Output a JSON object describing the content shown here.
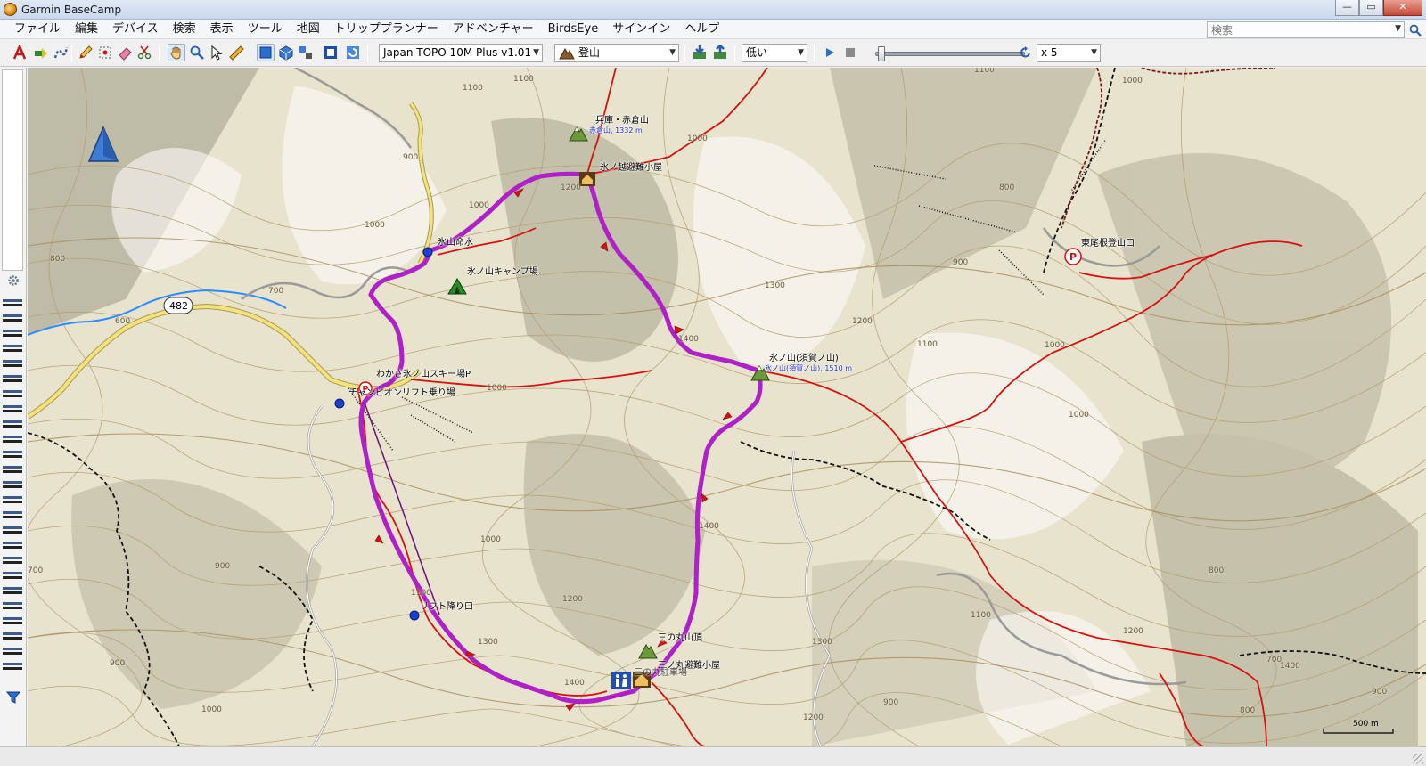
{
  "window": {
    "title": "Garmin BaseCamp",
    "minimize": "—",
    "maximize": "▭",
    "close": "✕"
  },
  "menu": [
    "ファイル",
    "編集",
    "デバイス",
    "検索",
    "表示",
    "ツール",
    "地図",
    "トリッププランナー",
    "アドベンチャー",
    "BirdsEye",
    "サインイン",
    "ヘルプ"
  ],
  "search": {
    "placeholder": "検索"
  },
  "toolbar": {
    "map_product": "Japan TOPO 10M Plus v1.01",
    "activity_profile": "登山",
    "detail_level": "低い",
    "playback_speed": "x 5"
  },
  "map": {
    "places": {
      "akakura_name": "兵庫・赤倉山",
      "akakura_elev": "赤倉山, 1332 m",
      "hinokoshi_hut": "氷ノ越避難小屋",
      "hiyama_water": "氷山命水",
      "camp": "氷ノ山キャンプ場",
      "summit_name": "氷ノ山(須賀ノ山)",
      "summit_elev": "氷ノ山(須賀ノ山), 1510 m",
      "wakasa_ski": "わかさ氷ノ山スキー場P",
      "lift_start": "チャンピオンリフト乗り場",
      "lift_end": "リフト降り口",
      "sannomaru_top": "三の丸山頂",
      "sannomaru_hut": "三ノ丸避難小屋",
      "sannomaru_wc": "三の丸駐車場",
      "higashi_trailhead": "東尾根登山口",
      "route_number": "482"
    },
    "contours": [
      "1100",
      "1000",
      "1100",
      "1000",
      "900",
      "1200",
      "1000",
      "700",
      "1100",
      "1000",
      "800",
      "900",
      "1300",
      "1200",
      "1100",
      "1400",
      "1000",
      "800",
      "600",
      "700",
      "900",
      "1000",
      "1100",
      "1200",
      "1300",
      "1400",
      "1400",
      "1000",
      "800",
      "700",
      "900",
      "1000",
      "1100",
      "1000",
      "1300",
      "1200",
      "1200",
      "1400",
      "800",
      "900",
      "900"
    ],
    "scale_label": "500 m"
  },
  "colors": {
    "track": "#b020c8",
    "trail": "#d81010",
    "road": "#f4e27a",
    "river": "#2a8cff",
    "contour": "#b59a6c"
  }
}
